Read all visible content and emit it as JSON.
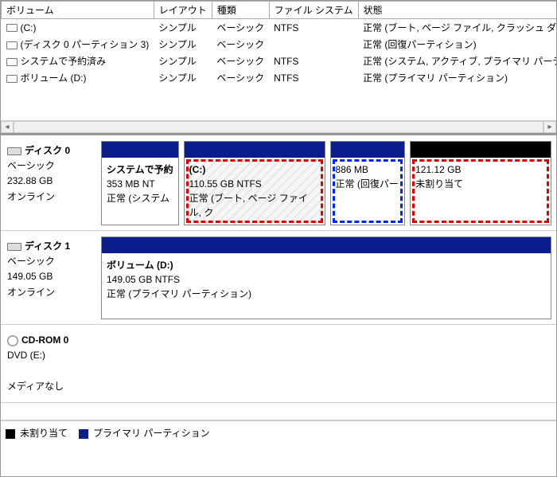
{
  "columns": {
    "volume": "ボリューム",
    "layout": "レイアウト",
    "type": "種類",
    "fs": "ファイル システム",
    "status": "状態"
  },
  "volumes": [
    {
      "name": "(C:)",
      "layout": "シンプル",
      "type": "ベーシック",
      "fs": "NTFS",
      "status": "正常 (ブート, ページ ファイル, クラッシュ ダンプ, プライマリ パ"
    },
    {
      "name": "(ディスク 0 パーティション 3)",
      "layout": "シンプル",
      "type": "ベーシック",
      "fs": "",
      "status": "正常 (回復パーティション)"
    },
    {
      "name": "システムで予約済み",
      "layout": "シンプル",
      "type": "ベーシック",
      "fs": "NTFS",
      "status": "正常 (システム, アクティブ, プライマリ パーティション)"
    },
    {
      "name": "ボリューム (D:)",
      "layout": "シンプル",
      "type": "ベーシック",
      "fs": "NTFS",
      "status": "正常 (プライマリ パーティション)"
    }
  ],
  "disks": [
    {
      "name": "ディスク 0",
      "kind": "ベーシック",
      "size": "232.88 GB",
      "state": "オンライン",
      "partitions": [
        {
          "title": "システムで予約",
          "line2": "353 MB NT",
          "line3": "正常 (システム",
          "flex": 7,
          "cls": ""
        },
        {
          "title": "(C:)",
          "line2": "110.55 GB NTFS",
          "line3": "正常 (ブート, ページ ファイル, ク",
          "flex": 19,
          "cls": "hatched",
          "hi": "red"
        },
        {
          "title": "",
          "line2": "886 MB",
          "line3": "正常 (回復パー",
          "flex": 10,
          "cls": "",
          "hi": "blue"
        },
        {
          "title": "",
          "line2": "121.12 GB",
          "line3": "未割り当て",
          "flex": 19,
          "cls": "unalloc",
          "hi": "red"
        }
      ]
    },
    {
      "name": "ディスク 1",
      "kind": "ベーシック",
      "size": "149.05 GB",
      "state": "オンライン",
      "partitions": [
        {
          "title": "ボリューム  (D:)",
          "line2": "149.05 GB NTFS",
          "line3": "正常 (プライマリ パーティション)",
          "flex": 1,
          "cls": ""
        }
      ]
    }
  ],
  "cdrom": {
    "name": "CD-ROM 0",
    "drive": "DVD (E:)",
    "media": "メディアなし"
  },
  "legend": {
    "unalloc": "未割り当て",
    "primary": "プライマリ パーティション"
  }
}
